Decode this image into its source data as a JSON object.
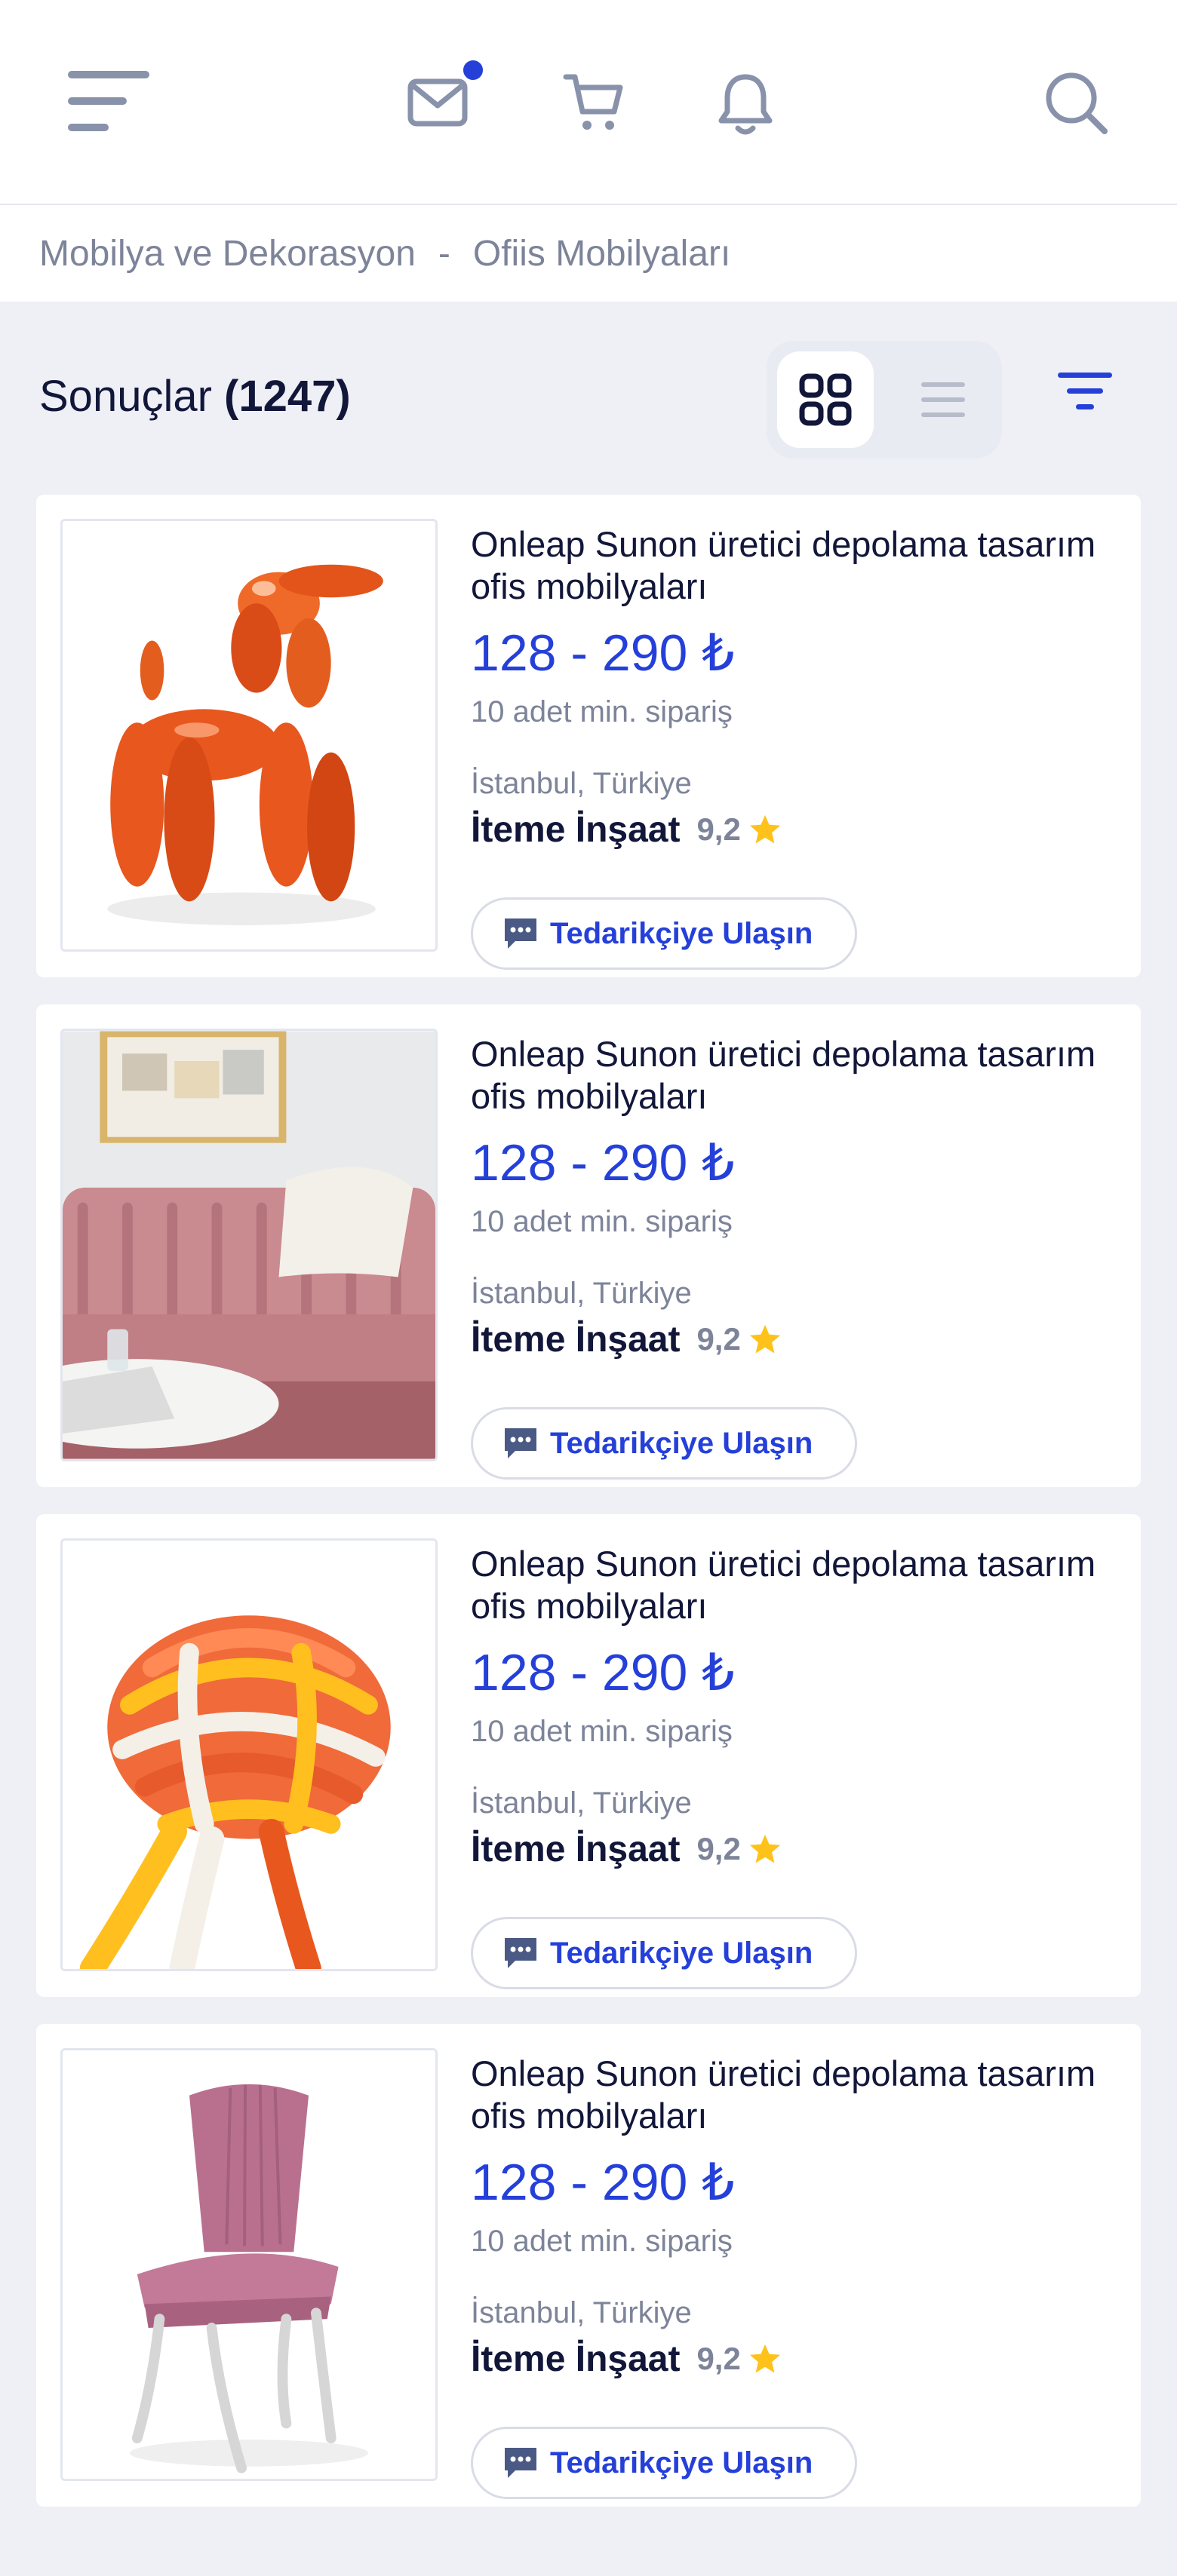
{
  "header": {
    "icons": [
      "menu-icon",
      "mail-icon",
      "cart-icon",
      "bell-icon",
      "search-icon"
    ],
    "mail_has_badge": true,
    "accent_color": "#2540d9"
  },
  "breadcrumb": {
    "items": [
      "Mobilya ve Dekorasyon",
      "Ofiis Mobilyaları"
    ],
    "separator": "-"
  },
  "results": {
    "label": "Sonuçlar",
    "count": "(1247)",
    "view_modes": [
      "grid",
      "list"
    ],
    "active_view": "grid"
  },
  "products": [
    {
      "title": "Onleap Sunon üretici depolama tasarım ofis mobilyaları",
      "price": "128 - 290 ₺",
      "min_order": "10 adet min. sipariş",
      "location": "İstanbul, Türkiye",
      "supplier": "İteme İnşaat",
      "rating": "9,2",
      "contact_label": "Tedarikçiye Ulaşın",
      "image": "orange balloon dog sculpture"
    },
    {
      "title": "Onleap Sunon üretici depolama tasarım ofis mobilyaları",
      "price": "128 - 290 ₺",
      "min_order": "10 adet min. sipariş",
      "location": "İstanbul, Türkiye",
      "supplier": "İteme İnşaat",
      "rating": "9,2",
      "contact_label": "Tedarikçiye Ulaşın",
      "image": "pink velvet sofa"
    },
    {
      "title": "Onleap Sunon üretici depolama tasarım ofis mobilyaları",
      "price": "128 - 290 ₺",
      "min_order": "10 adet min. sipariş",
      "location": "İstanbul, Türkiye",
      "supplier": "İteme İnşaat",
      "rating": "9,2",
      "contact_label": "Tedarikçiye Ulaşın",
      "image": "knotted rope toy"
    },
    {
      "title": "Onleap Sunon üretici depolama tasarım ofis mobilyaları",
      "price": "128 - 290 ₺",
      "min_order": "10 adet min. sipariş",
      "location": "İstanbul, Türkiye",
      "supplier": "İteme İnşaat",
      "rating": "9,2",
      "contact_label": "Tedarikçiye Ulaşın",
      "image": "pink upholstered chair"
    }
  ]
}
